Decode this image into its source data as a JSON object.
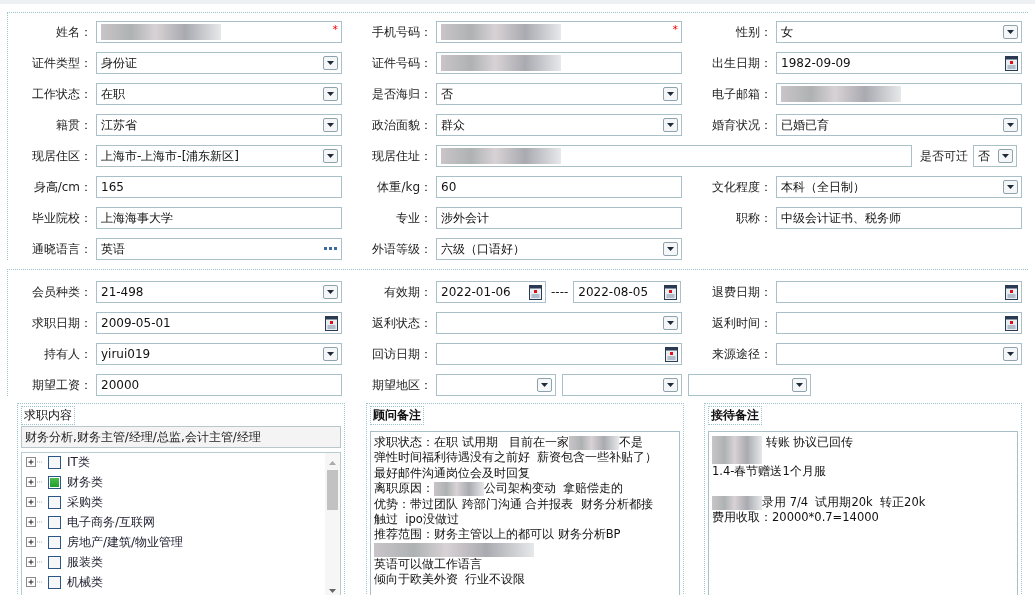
{
  "profile": {
    "rows": [
      [
        {
          "label": "姓名：",
          "kind": "masked",
          "required_mark": "*"
        },
        {
          "label": "手机号码：",
          "kind": "masked",
          "required_mark": "*"
        },
        {
          "label": "性别：",
          "kind": "select",
          "value": "女"
        }
      ],
      [
        {
          "label": "证件类型：",
          "kind": "select",
          "value": "身份证"
        },
        {
          "label": "证件号码：",
          "kind": "masked"
        },
        {
          "label": "出生日期：",
          "kind": "date",
          "value": "1982-09-09"
        }
      ],
      [
        {
          "label": "工作状态：",
          "kind": "select",
          "value": "在职"
        },
        {
          "label": "是否海归：",
          "kind": "select",
          "value": "否"
        },
        {
          "label": "电子邮箱：",
          "kind": "masked"
        }
      ],
      [
        {
          "label": "籍贯：",
          "kind": "select",
          "value": "江苏省"
        },
        {
          "label": "政治面貌：",
          "kind": "select",
          "value": "群众"
        },
        {
          "label": "婚育状况：",
          "kind": "select",
          "value": "已婚已育"
        }
      ],
      [
        {
          "label": "现居住区：",
          "kind": "select",
          "value": "上海市-上海市-[浦东新区]"
        },
        {
          "label": "现居住址：",
          "kind": "masked",
          "extra": {
            "label": "是否可迁",
            "kind": "select",
            "value": "否"
          }
        }
      ],
      [
        {
          "label": "身高/cm：",
          "kind": "text",
          "value": "165"
        },
        {
          "label": "体重/kg：",
          "kind": "text",
          "value": "60"
        },
        {
          "label": "文化程度：",
          "kind": "select",
          "value": "本科（全日制）"
        }
      ],
      [
        {
          "label": "毕业院校：",
          "kind": "text",
          "value": "上海海事大学"
        },
        {
          "label": "专业：",
          "kind": "text",
          "value": "涉外会计"
        },
        {
          "label": "职称：",
          "kind": "text",
          "value": "中级会计证书、税务师"
        }
      ],
      [
        {
          "label": "通晓语言：",
          "kind": "more",
          "value": "英语"
        },
        {
          "label": "外语等级：",
          "kind": "select",
          "value": "六级（口语好）"
        }
      ]
    ]
  },
  "membership": {
    "rows": [
      [
        {
          "label": "会员种类：",
          "kind": "select",
          "value": "21-498"
        },
        {
          "label": "有效期：",
          "kind": "daterange",
          "values": [
            "2022-01-06",
            "2022-08-05"
          ],
          "separator": "----"
        },
        {
          "label": "退费日期：",
          "kind": "date"
        }
      ],
      [
        {
          "label": "求职日期：",
          "kind": "date",
          "value": "2009-05-01"
        },
        {
          "label": "返利状态：",
          "kind": "select"
        },
        {
          "label": "返利时间：",
          "kind": "date"
        }
      ],
      [
        {
          "label": "持有人：",
          "kind": "select",
          "value": "yirui019"
        },
        {
          "label": "回访日期：",
          "kind": "date"
        },
        {
          "label": "来源途径：",
          "kind": "select"
        }
      ],
      [
        {
          "label": "期望工资：",
          "kind": "text",
          "value": "20000"
        },
        {
          "label": "期望地区：",
          "kind": "multiselect",
          "selects": [
            {
              "kind": "select"
            },
            {
              "kind": "select"
            },
            {
              "kind": "select"
            }
          ]
        }
      ]
    ]
  },
  "job_intent": {
    "title": "求职内容",
    "value": "财务分析,财务主管/经理/总监,会计主管/经理",
    "tree": [
      {
        "label": "IT类",
        "checked": false,
        "expanded": false
      },
      {
        "label": "财务类",
        "checked": true,
        "expanded": false
      },
      {
        "label": "采购类",
        "checked": false,
        "expanded": false
      },
      {
        "label": "电子商务/互联网",
        "checked": false,
        "expanded": false
      },
      {
        "label": "房地产/建筑/物业管理",
        "checked": false,
        "expanded": false
      },
      {
        "label": "服装类",
        "checked": false,
        "expanded": false
      },
      {
        "label": "机械类",
        "checked": false,
        "expanded": false
      }
    ]
  },
  "consultant_notes": {
    "title": "顾问备注",
    "lines": [
      {
        "parts": [
          {
            "kind": "text",
            "text": "求职状态：在职 试用期   目前在一家"
          },
          {
            "kind": "masked"
          },
          {
            "kind": "text",
            "text": "不是"
          }
        ]
      },
      {
        "parts": [
          {
            "kind": "text",
            "text": "弹性时间福利待遇没有之前好  薪资包含一些补贴了）"
          }
        ]
      },
      {
        "parts": [
          {
            "kind": "text",
            "text": "最好邮件沟通岗位会及时回复"
          }
        ]
      },
      {
        "parts": [
          {
            "kind": "text",
            "text": "离职原因："
          },
          {
            "kind": "masked"
          },
          {
            "kind": "text",
            "text": "公司架构变动  拿赔偿走的"
          }
        ]
      },
      {
        "parts": [
          {
            "kind": "text",
            "text": "优势：带过团队 跨部门沟通 合并报表  财务分析都接"
          }
        ]
      },
      {
        "parts": [
          {
            "kind": "text",
            "text": "触过  ipo没做过"
          }
        ]
      },
      {
        "parts": [
          {
            "kind": "text",
            "text": "推荐范围：财务主管以上的都可以 财务分析BP"
          }
        ]
      },
      {
        "parts": [
          {
            "kind": "masked"
          }
        ]
      },
      {
        "parts": [
          {
            "kind": "text",
            "text": "英语可以做工作语言"
          }
        ]
      },
      {
        "parts": [
          {
            "kind": "text",
            "text": "倾向于欧美外资  行业不设限"
          }
        ]
      }
    ]
  },
  "reception_notes": {
    "title": "接待备注",
    "lines": [
      {
        "parts": [
          {
            "kind": "masked"
          },
          {
            "kind": "text",
            "text": " 转账 协议已回传"
          }
        ]
      },
      {
        "parts": [
          {
            "kind": "masked"
          }
        ]
      },
      {
        "parts": [
          {
            "kind": "text",
            "text": "1.4-春节赠送1个月服"
          }
        ]
      },
      {
        "blank_before": true,
        "parts": [
          {
            "kind": "masked"
          },
          {
            "kind": "text",
            "text": "录用 7/4  试用期20k  转正20k"
          }
        ]
      },
      {
        "parts": [
          {
            "kind": "text",
            "text": "费用收取：20000*0.7=14000"
          }
        ]
      }
    ]
  }
}
